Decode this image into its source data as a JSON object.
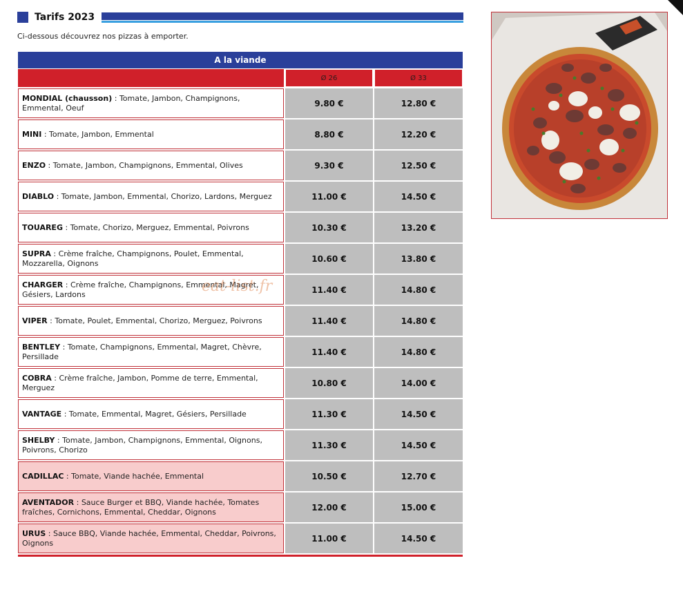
{
  "section": {
    "title": "Tarifs 2023"
  },
  "intro": "Ci-dessous découvrez nos pizzas à emporter.",
  "category": {
    "title": "A la viande",
    "size_small": "Ø 26",
    "size_large": "Ø 33"
  },
  "pizzas": [
    {
      "name": "MONDIAL (chausson)",
      "ingredients": "Tomate, Jambon, Champignons, Emmental, Oeuf",
      "price_26": "9.80 €",
      "price_33": "12.80 €",
      "highlight": false
    },
    {
      "name": "MINI",
      "ingredients": "Tomate, Jambon, Emmental",
      "price_26": "8.80 €",
      "price_33": "12.20 €",
      "highlight": false
    },
    {
      "name": "ENZO",
      "ingredients": "Tomate, Jambon, Champignons, Emmental, Olives",
      "price_26": "9.30 €",
      "price_33": "12.50 €",
      "highlight": false
    },
    {
      "name": "DIABLO",
      "ingredients": "Tomate, Jambon, Emmental, Chorizo, Lardons, Merguez",
      "price_26": "11.00 €",
      "price_33": "14.50 €",
      "highlight": false
    },
    {
      "name": "TOUAREG",
      "ingredients": "Tomate, Chorizo, Merguez, Emmental, Poivrons",
      "price_26": "10.30 €",
      "price_33": "13.20 €",
      "highlight": false
    },
    {
      "name": "SUPRA",
      "ingredients": "Crème fraîche, Champignons, Poulet, Emmental, Mozzarella, Oignons",
      "price_26": "10.60 €",
      "price_33": "13.80 €",
      "highlight": false
    },
    {
      "name": "CHARGER",
      "ingredients": "Crème fraîche, Champignons, Emmental, Magret, Gésiers, Lardons",
      "price_26": "11.40 €",
      "price_33": "14.80 €",
      "highlight": false
    },
    {
      "name": "VIPER",
      "ingredients": "Tomate, Poulet, Emmental, Chorizo, Merguez, Poivrons",
      "price_26": "11.40 €",
      "price_33": "14.80 €",
      "highlight": false
    },
    {
      "name": "BENTLEY",
      "ingredients": "Tomate, Champignons, Emmental, Magret, Chèvre, Persillade",
      "price_26": "11.40 €",
      "price_33": "14.80 €",
      "highlight": false
    },
    {
      "name": "COBRA",
      "ingredients": "Crème fraîche, Jambon, Pomme de terre, Emmental, Merguez",
      "price_26": "10.80 €",
      "price_33": "14.00 €",
      "highlight": false
    },
    {
      "name": "VANTAGE",
      "ingredients": "Tomate, Emmental, Magret, Gésiers, Persillade",
      "price_26": "11.30 €",
      "price_33": "14.50 €",
      "highlight": false
    },
    {
      "name": "SHELBY",
      "ingredients": "Tomate, Jambon, Champignons, Emmental, Oignons, Poivrons, Chorizo",
      "price_26": "11.30 €",
      "price_33": "14.50 €",
      "highlight": false
    },
    {
      "name": "CADILLAC",
      "ingredients": "Tomate, Viande hachée, Emmental",
      "price_26": "10.50 €",
      "price_33": "12.70 €",
      "highlight": true
    },
    {
      "name": "AVENTADOR",
      "ingredients": "Sauce Burger et BBQ, Viande hachée, Tomates fraîches, Cornichons, Emmental, Cheddar, Oignons",
      "price_26": "12.00 €",
      "price_33": "15.00 €",
      "highlight": true
    },
    {
      "name": "URUS",
      "ingredients": "Sauce BBQ, Viande hachée, Emmental, Cheddar, Poivrons, Oignons",
      "price_26": "11.00 €",
      "price_33": "14.50 €",
      "highlight": true
    }
  ],
  "watermark": "eat-list.fr",
  "colors": {
    "header_blue": "#2a3f9a",
    "header_red": "#d0202a",
    "price_bg": "#bebebe",
    "highlight_bg": "#f8cccc"
  },
  "photo": {
    "icon": "pizza-photo"
  }
}
